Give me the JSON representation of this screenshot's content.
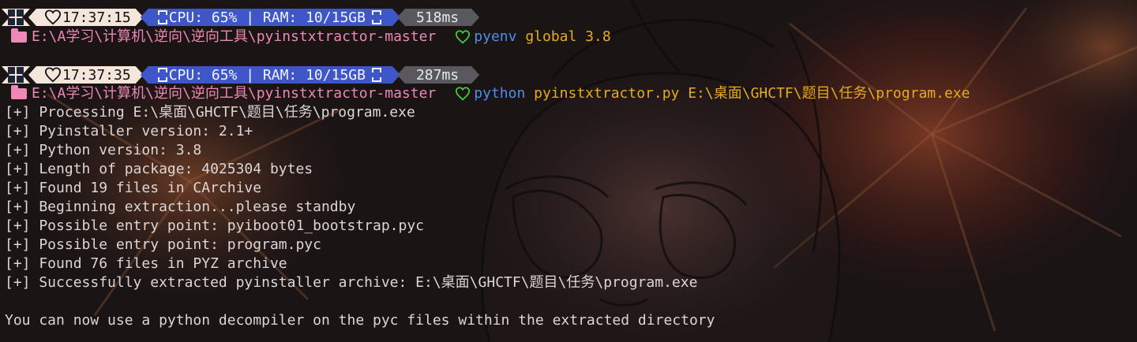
{
  "theme": {
    "accent_cream": "#f5e6dc",
    "accent_blue": "#3e56c8",
    "accent_gray": "#58585e",
    "path_pink": "#ee88b6",
    "command_blue": "#4e8eea",
    "args_yellow": "#e6ab1e",
    "heart_green": "#3ecf3e"
  },
  "prompts": [
    {
      "icons": [
        "windows-logo-icon",
        "heart-icon",
        "chip-icon",
        "chip-icon"
      ],
      "time": "17:37:15",
      "cpu_label": "CPU: 65% | RAM: 10/15GB",
      "duration": "518ms",
      "path": "E:\\A学习\\计算机\\逆向\\逆向工具\\pyinstxtractor-master",
      "command": "pyenv",
      "args": "global 3.8"
    },
    {
      "icons": [
        "windows-logo-icon",
        "heart-icon",
        "chip-icon",
        "chip-icon"
      ],
      "time": "17:37:35",
      "cpu_label": "CPU: 65% | RAM: 10/15GB",
      "duration": "287ms",
      "path": "E:\\A学习\\计算机\\逆向\\逆向工具\\pyinstxtractor-master",
      "command": "python",
      "args": "pyinstxtractor.py E:\\桌面\\GHCTF\\题目\\任务\\program.exe"
    }
  ],
  "output_lines": [
    "[+] Processing E:\\桌面\\GHCTF\\题目\\任务\\program.exe",
    "[+] Pyinstaller version: 2.1+",
    "[+] Python version: 3.8",
    "[+] Length of package: 4025304 bytes",
    "[+] Found 19 files in CArchive",
    "[+] Beginning extraction...please standby",
    "[+] Possible entry point: pyiboot01_bootstrap.pyc",
    "[+] Possible entry point: program.pyc",
    "[+] Found 76 files in PYZ archive",
    "[+] Successfully extracted pyinstaller archive: E:\\桌面\\GHCTF\\题目\\任务\\program.exe",
    "",
    "You can now use a python decompiler on the pyc files within the extracted directory"
  ]
}
